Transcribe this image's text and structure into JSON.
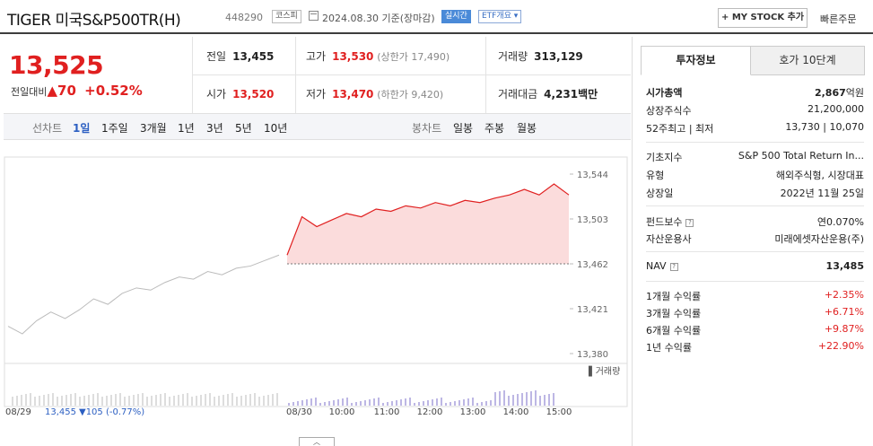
{
  "header": {
    "name": "TIGER 미국S&P500TR(H)",
    "code": "448290",
    "market": "코스피",
    "date": "2024.08.30 기준(장마감)",
    "live": "실시간",
    "etf_overview": "ETF개요",
    "my_stock": "+ MY STOCK 추가",
    "quick_order": "빠른주문"
  },
  "price": {
    "current": "13,525",
    "change_label": "전일대비",
    "change": "▲70",
    "change_pct": "+0.52%",
    "prev_close_label": "전일",
    "prev_close": "13,455",
    "high_label": "고가",
    "high": "13,530",
    "upper_limit": "(상한가 17,490)",
    "volume_label": "거래량",
    "volume": "313,129",
    "open_label": "시가",
    "open": "13,520",
    "low_label": "저가",
    "low": "13,470",
    "lower_limit": "(하한가 9,420)",
    "amount_label": "거래대금",
    "amount": "4,231",
    "amount_unit": "백만"
  },
  "tabs": {
    "line_label": "선차트",
    "line": [
      "1일",
      "1주일",
      "3개월",
      "1년",
      "3년",
      "5년",
      "10년"
    ],
    "active": "1일",
    "candle_label": "봉차트",
    "candle": [
      "일봉",
      "주봉",
      "월봉"
    ]
  },
  "chart_data": {
    "type": "line",
    "series": [
      {
        "name": "08/29",
        "values": [
          13405,
          13398,
          13410,
          13418,
          13412,
          13420,
          13430,
          13425,
          13435,
          13440,
          13438,
          13445,
          13450,
          13448,
          13455,
          13452,
          13458,
          13460,
          13465,
          13470
        ]
      },
      {
        "name": "08/30",
        "values": [
          13470,
          13505,
          13496,
          13502,
          13508,
          13505,
          13512,
          13510,
          13515,
          13513,
          13518,
          13515,
          13520,
          13518,
          13522,
          13525,
          13530,
          13525,
          13535,
          13525
        ]
      }
    ],
    "prev_close": 13462,
    "ylim": [
      13380,
      13544
    ],
    "y_ticks": [
      "13,544",
      "13,503",
      "13,462",
      "13,421",
      "13,380"
    ],
    "x_labels": [
      "08/30",
      "10:00",
      "11:00",
      "12:00",
      "13:00",
      "14:00",
      "15:00"
    ],
    "volume_label": "거래량",
    "volume_note_date": "08/29",
    "volume_note_value": "13,455",
    "volume_note_change": "▼105 (-0.77%)",
    "colors": {
      "up": "#e02020",
      "fill": "#fbdcdc",
      "prev": "#bbbbbb",
      "volume": "#7b6fc8"
    }
  },
  "right": {
    "tab_active": "투자정보",
    "tab_other": "호가 10단계",
    "rows1": [
      {
        "k": "시가총액",
        "v": "2,867",
        "unit": "억원"
      },
      {
        "k": "상장주식수",
        "v": "21,200,000"
      },
      {
        "k": "52주최고 | 최저",
        "v": "13,730 | 10,070"
      }
    ],
    "rows2": [
      {
        "k": "기초지수",
        "v": "S&P 500 Total Return In..."
      },
      {
        "k": "유형",
        "v": "해외주식형, 시장대표"
      },
      {
        "k": "상장일",
        "v": "2022년 11월 25일"
      }
    ],
    "rows3": [
      {
        "k": "펀드보수",
        "v": "연0.070%"
      },
      {
        "k": "자산운용사",
        "v": "미래에셋자산운용(주)"
      }
    ],
    "nav": {
      "k": "NAV",
      "v": "13,485"
    },
    "returns": [
      {
        "k": "1개월 수익률",
        "v": "+2.35%"
      },
      {
        "k": "3개월 수익률",
        "v": "+6.71%"
      },
      {
        "k": "6개월 수익률",
        "v": "+9.87%"
      },
      {
        "k": "1년 수익률",
        "v": "+22.90%"
      }
    ]
  }
}
